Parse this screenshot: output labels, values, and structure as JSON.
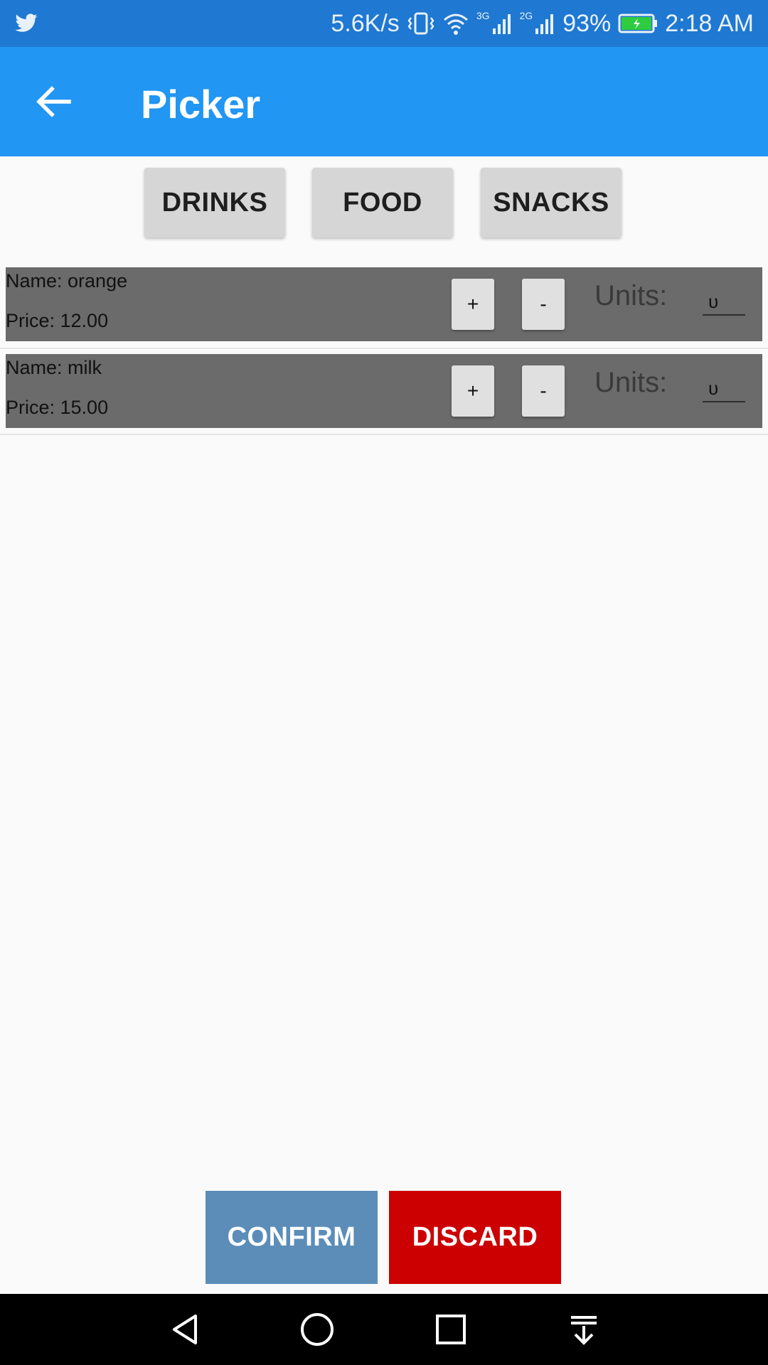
{
  "status_bar": {
    "network_speed": "5.6K/s",
    "net_3g": "3G",
    "net_2g": "2G",
    "battery": "93%",
    "time": "2:18 AM",
    "icons": [
      "twitter-icon",
      "vibrate-icon",
      "wifi-icon",
      "signal-icon",
      "signal-icon",
      "battery-charging-icon"
    ]
  },
  "app_bar": {
    "title": "Picker",
    "back_icon": "arrow-back-icon"
  },
  "categories": [
    "DRINKS",
    "FOOD",
    "SNACKS"
  ],
  "items": [
    {
      "name": "Name: orange",
      "price": "Price: 12.00",
      "plus": "+",
      "minus": "-",
      "units_label": "Units:",
      "units_value": "ᴜ"
    },
    {
      "name": "Name: milk",
      "price": "Price: 15.00",
      "plus": "+",
      "minus": "-",
      "units_label": "Units:",
      "units_value": "ᴜ"
    }
  ],
  "actions": {
    "confirm": "CONFIRM",
    "discard": "DISCARD"
  },
  "nav_bar": {
    "icons": [
      "nav-back-icon",
      "nav-home-icon",
      "nav-recents-icon",
      "nav-notifications-icon"
    ]
  },
  "colors": {
    "status_bar": "#1f78d1",
    "app_bar": "#2196f3",
    "item_row": "#6b6b6b",
    "confirm": "#5b8db8",
    "discard": "#cc0000"
  }
}
